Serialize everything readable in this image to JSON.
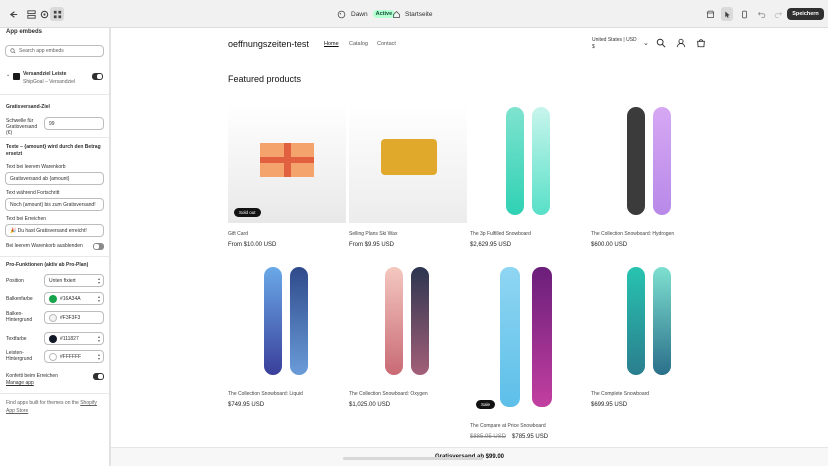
{
  "topbar": {
    "theme_name": "Dawn",
    "theme_status": "Active",
    "page_name": "Startseite",
    "save_label": "Speichern"
  },
  "sidebar": {
    "title": "App embeds",
    "search_placeholder": "Search app embeds",
    "embed_name": "Versandziel Leiste",
    "embed_subtitle": "ShipGoal – Versandziel",
    "embed_enabled": true,
    "section_goal": "Gratisversand-Ziel",
    "threshold_label": "Schwelle für Gratisversand (€)",
    "threshold_value": "99",
    "texts_header": "Texte – {amount} wird durch den Betrag ersetzt",
    "empty_cart_label": "Text bei leerem Warenkorb",
    "empty_cart_value": "Gratisversand ab {amount}",
    "progress_label": "Text während Fortschritt",
    "progress_value": "Noch {amount} bis zum Gratisversand!",
    "reached_label": "Text bei Erreichen",
    "reached_value": "🎉 Du hast Gratisversand erreicht!",
    "hide_empty_label": "Bei leerem Warenkorb ausblenden",
    "hide_empty_enabled": false,
    "pro_header": "Pro-Funktionen (aktiv ab Pro-Plan)",
    "position_label": "Position",
    "position_value": "Unten fixiert",
    "bar_color_label": "Balkenfarbe",
    "bar_color_value": "#16A34A",
    "bar_bg_label": "Balken-Hintergrund",
    "bar_bg_value": "#F3F3F3",
    "text_color_label": "Textfarbe",
    "text_color_value": "#111827",
    "strip_bg_label": "Leisten-Hintergrund",
    "strip_bg_value": "#FFFFFF",
    "confetti_label": "Konfetti beim Erreichen",
    "confetti_enabled": true,
    "manage_app": "Manage app",
    "footer_text": "Find apps built for themes on the",
    "footer_link": "Shopify App Store"
  },
  "store": {
    "name": "oeffnungszeiten-test",
    "nav": [
      "Home",
      "Catalog",
      "Contact"
    ],
    "country": "United States | USD $",
    "section_title": "Featured products",
    "bottom_bar_text": "Gratisversand ab $99.00",
    "products": [
      {
        "title": "Gift Card",
        "price": "From $10.00 USD",
        "badge": "Sold out"
      },
      {
        "title": "Selling Plans Ski Wax",
        "price": "From $9.95 USD",
        "badge": ""
      },
      {
        "title": "The 3p Fulfilled Snowboard",
        "price": "$2,629.95 USD",
        "badge": ""
      },
      {
        "title": "The Collection Snowboard: Hydrogen",
        "price": "$600.00 USD",
        "badge": ""
      },
      {
        "title": "The Collection Snowboard: Liquid",
        "price": "$749.95 USD",
        "badge": ""
      },
      {
        "title": "The Collection Snowboard: Oxygen",
        "price": "$1,025.00 USD",
        "badge": ""
      },
      {
        "title": "The Compare at Price Snowboard",
        "price": "$785.95 USD",
        "compare_price": "$885.95 USD",
        "badge": "Sale"
      },
      {
        "title": "The Complete Snowboard",
        "price": "$699.95 USD",
        "badge": ""
      }
    ]
  },
  "colors": {
    "bar": "#16A34A",
    "bar_bg": "#F3F3F3",
    "text": "#111827",
    "strip_bg": "#FFFFFF"
  }
}
